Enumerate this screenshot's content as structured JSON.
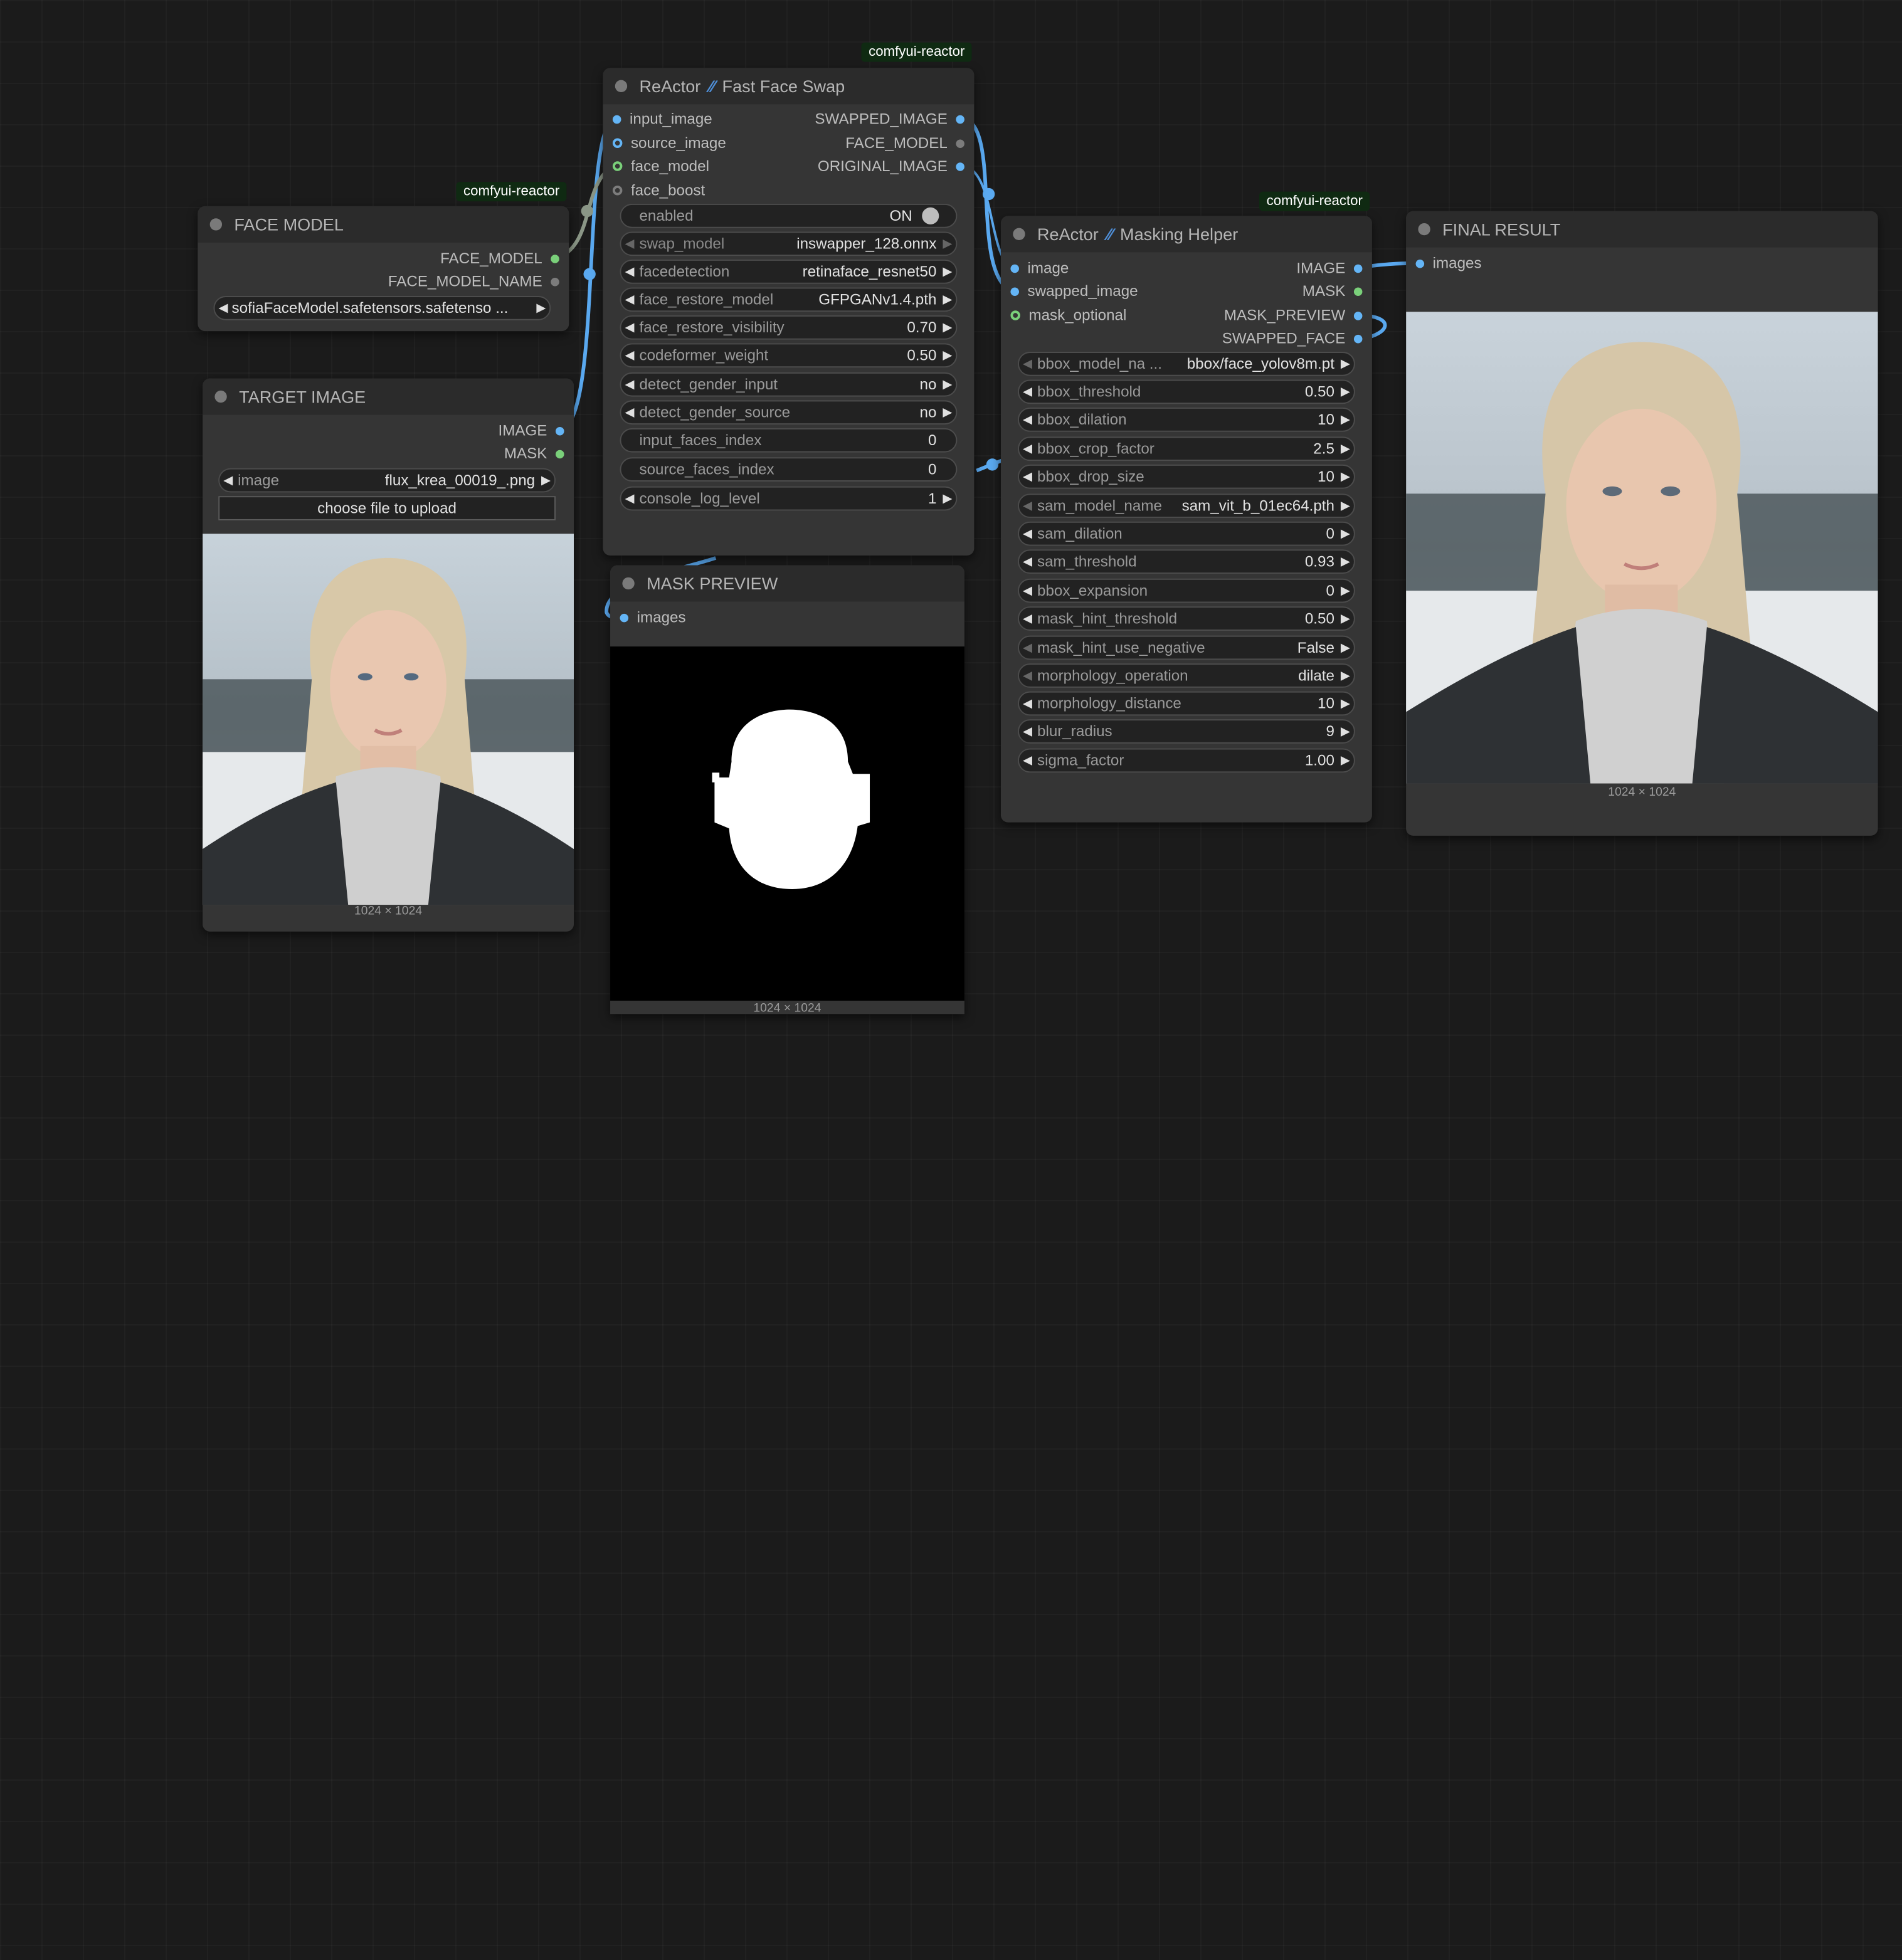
{
  "badges": {
    "fast_face_swap": "comfyui-reactor",
    "face_model": "comfyui-reactor",
    "masking_helper": "comfyui-reactor"
  },
  "face_model_node": {
    "title": "FACE MODEL",
    "outputs": [
      "FACE_MODEL",
      "FACE_MODEL_NAME"
    ],
    "select_value": "sofiaFaceModel.safetensors.safetenso ..."
  },
  "target_image_node": {
    "title": "TARGET IMAGE",
    "outputs": [
      "IMAGE",
      "MASK"
    ],
    "image_widget": {
      "label": "image",
      "value": "flux_krea_00019_.png"
    },
    "upload_label": "choose file to upload",
    "caption": "1024 × 1024"
  },
  "fast_face_swap_node": {
    "title_prefix": "ReActor",
    "title_suffix": "Fast Face Swap",
    "inputs": [
      "input_image",
      "source_image",
      "face_model",
      "face_boost"
    ],
    "outputs": [
      "SWAPPED_IMAGE",
      "FACE_MODEL",
      "ORIGINAL_IMAGE"
    ],
    "widgets": [
      {
        "label": "enabled",
        "value": "ON"
      },
      {
        "label": "swap_model",
        "value": "inswapper_128.onnx"
      },
      {
        "label": "facedetection",
        "value": "retinaface_resnet50"
      },
      {
        "label": "face_restore_model",
        "value": "GFPGANv1.4.pth"
      },
      {
        "label": "face_restore_visibility",
        "value": "0.70"
      },
      {
        "label": "codeformer_weight",
        "value": "0.50"
      },
      {
        "label": "detect_gender_input",
        "value": "no"
      },
      {
        "label": "detect_gender_source",
        "value": "no"
      },
      {
        "label": "input_faces_index",
        "value": "0"
      },
      {
        "label": "source_faces_index",
        "value": "0"
      },
      {
        "label": "console_log_level",
        "value": "1"
      }
    ]
  },
  "mask_preview_node": {
    "title": "MASK PREVIEW",
    "inputs": [
      "images"
    ],
    "caption": "1024 × 1024"
  },
  "masking_helper_node": {
    "title_prefix": "ReActor",
    "title_suffix": "Masking Helper",
    "inputs": [
      "image",
      "swapped_image",
      "mask_optional"
    ],
    "outputs": [
      "IMAGE",
      "MASK",
      "MASK_PREVIEW",
      "SWAPPED_FACE"
    ],
    "widgets": [
      {
        "label": "bbox_model_na ...",
        "value": "bbox/face_yolov8m.pt"
      },
      {
        "label": "bbox_threshold",
        "value": "0.50"
      },
      {
        "label": "bbox_dilation",
        "value": "10"
      },
      {
        "label": "bbox_crop_factor",
        "value": "2.5"
      },
      {
        "label": "bbox_drop_size",
        "value": "10"
      },
      {
        "label": "sam_model_name",
        "value": "sam_vit_b_01ec64.pth"
      },
      {
        "label": "sam_dilation",
        "value": "0"
      },
      {
        "label": "sam_threshold",
        "value": "0.93"
      },
      {
        "label": "bbox_expansion",
        "value": "0"
      },
      {
        "label": "mask_hint_threshold",
        "value": "0.50"
      },
      {
        "label": "mask_hint_use_negative",
        "value": "False"
      },
      {
        "label": "morphology_operation",
        "value": "dilate"
      },
      {
        "label": "morphology_distance",
        "value": "10"
      },
      {
        "label": "blur_radius",
        "value": "9"
      },
      {
        "label": "sigma_factor",
        "value": "1.00"
      }
    ]
  },
  "final_result_node": {
    "title": "FINAL RESULT",
    "inputs": [
      "images"
    ],
    "caption": "1024 × 1024"
  },
  "colors": {
    "link": "#5aa9f0",
    "link_gray": "#8a9686",
    "badge_bg": "#0f2a12",
    "node_bg": "#353535",
    "canvas_bg": "#1b1b1b"
  }
}
